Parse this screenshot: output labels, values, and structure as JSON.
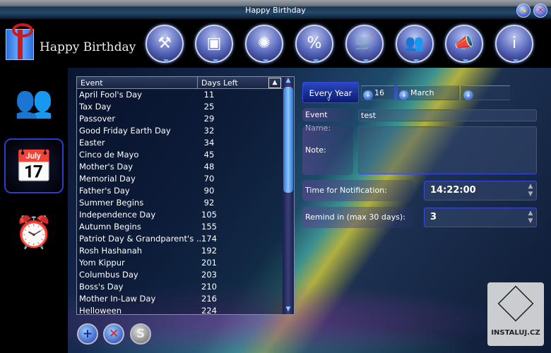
{
  "window": {
    "title": "Happy Birthday",
    "minimize_icon": "minimize-arrow-icon",
    "close_icon": "close-x-icon"
  },
  "logo": {
    "text": "Happy Birthday"
  },
  "toolbar": [
    {
      "name": "tools",
      "icon": "⚒"
    },
    {
      "name": "safe",
      "icon": "▣"
    },
    {
      "name": "themes",
      "icon": "✺"
    },
    {
      "name": "discount-users",
      "icon": "%"
    },
    {
      "name": "shopping-cart",
      "icon": "🛒"
    },
    {
      "name": "users",
      "icon": "👥"
    },
    {
      "name": "announce",
      "icon": "📣"
    },
    {
      "name": "info",
      "icon": "i"
    }
  ],
  "sidebar": [
    {
      "name": "contacts",
      "icon": "👥",
      "active": false
    },
    {
      "name": "events-calendar",
      "icon": "📅",
      "active": true
    },
    {
      "name": "alarm-clock",
      "icon": "⏰",
      "active": false
    }
  ],
  "table": {
    "columns": [
      "Event",
      "Days Left"
    ],
    "rows": [
      [
        "April Fool's Day",
        "11"
      ],
      [
        "Tax Day",
        "25"
      ],
      [
        "Passover",
        "29"
      ],
      [
        "Good Friday Earth Day",
        "32"
      ],
      [
        "Easter",
        "34"
      ],
      [
        "Cinco de Mayo",
        "45"
      ],
      [
        "Mother's Day",
        "48"
      ],
      [
        "Memorial Day",
        "70"
      ],
      [
        "Father's Day",
        "90"
      ],
      [
        "Summer Begins",
        "92"
      ],
      [
        "Independence Day",
        "105"
      ],
      [
        "Autumn Begins",
        "155"
      ],
      [
        "Patriot Day & Grandparent's ...",
        "174"
      ],
      [
        "Rosh Hashanah",
        "192"
      ],
      [
        "Yom Kippur",
        "201"
      ],
      [
        "Columbus Day",
        "203"
      ],
      [
        "Boss's Day",
        "210"
      ],
      [
        "Mother In-Law Day",
        "216"
      ],
      [
        "Helloween",
        "224"
      ]
    ]
  },
  "actions": {
    "add": "+",
    "delete": "✕",
    "refresh": "S"
  },
  "form": {
    "recurrence": "Every Year",
    "day": "16",
    "month": "March",
    "year": "",
    "event_name_label": "Event Name:",
    "event_name": "test",
    "note_label": "Note:",
    "note": "",
    "time_label": "Time for Notification:",
    "time": "14:22:00",
    "remind_label": "Remind in (max 30 days):",
    "remind": "3"
  },
  "watermark": {
    "text": "INSTALUJ.CZ"
  }
}
